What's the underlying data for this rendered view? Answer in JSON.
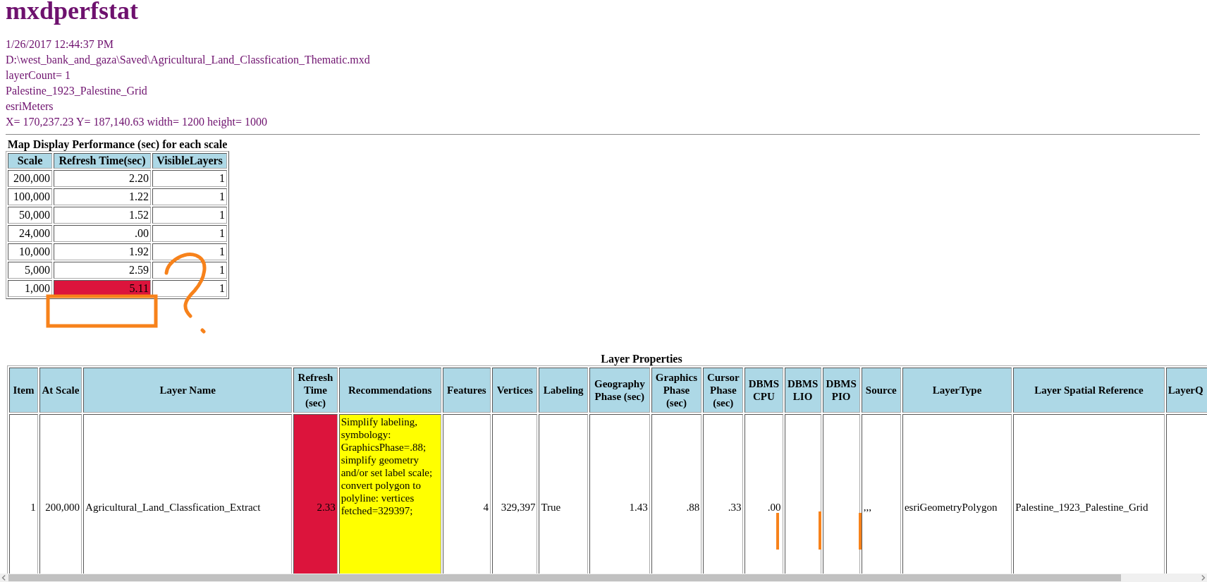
{
  "title": "mxdperfstat",
  "info_lines": [
    "1/26/2017 12:44:37 PM",
    "D:\\west_bank_and_gaza\\Saved\\Agricultural_Land_Classfication_Thematic.mxd",
    "layerCount= 1",
    "Palestine_1923_Palestine_Grid",
    "esriMeters",
    "X= 170,237.23 Y= 187,140.63 width= 1200 height= 1000"
  ],
  "scale_table": {
    "caption": "Map Display Performance (sec) for each scale",
    "columns": [
      "Scale",
      "Refresh Time(sec)",
      "VisibleLayers"
    ],
    "rows": [
      {
        "scale": "200,000",
        "refresh_time": "2.20",
        "visible_layers": "1",
        "alert": false
      },
      {
        "scale": "100,000",
        "refresh_time": "1.22",
        "visible_layers": "1",
        "alert": false
      },
      {
        "scale": "50,000",
        "refresh_time": "1.52",
        "visible_layers": "1",
        "alert": false
      },
      {
        "scale": "24,000",
        "refresh_time": ".00",
        "visible_layers": "1",
        "alert": false
      },
      {
        "scale": "10,000",
        "refresh_time": "1.92",
        "visible_layers": "1",
        "alert": false
      },
      {
        "scale": "5,000",
        "refresh_time": "2.59",
        "visible_layers": "1",
        "alert": false
      },
      {
        "scale": "1,000",
        "refresh_time": "5.11",
        "visible_layers": "1",
        "alert": true
      }
    ]
  },
  "layer_table": {
    "caption": "Layer Properties",
    "columns": [
      {
        "label": "Item",
        "kind": "number"
      },
      {
        "label": "At Scale",
        "kind": "number"
      },
      {
        "label": "Layer Name",
        "kind": "text"
      },
      {
        "label": "Refresh Time (sec)",
        "kind": "number"
      },
      {
        "label": "Recommendations",
        "kind": "text"
      },
      {
        "label": "Features",
        "kind": "number"
      },
      {
        "label": "Vertices",
        "kind": "number"
      },
      {
        "label": "Labeling",
        "kind": "text"
      },
      {
        "label": "Geography Phase (sec)",
        "kind": "number"
      },
      {
        "label": "Graphics Phase (sec)",
        "kind": "number"
      },
      {
        "label": "Cursor Phase (sec)",
        "kind": "number"
      },
      {
        "label": "DBMS CPU",
        "kind": "number"
      },
      {
        "label": "DBMS LIO",
        "kind": "number"
      },
      {
        "label": "DBMS PIO",
        "kind": "number"
      },
      {
        "label": "Source",
        "kind": "text"
      },
      {
        "label": "LayerType",
        "kind": "text"
      },
      {
        "label": "Layer Spatial Reference",
        "kind": "text"
      },
      {
        "label": "LayerQ",
        "kind": "text"
      }
    ],
    "rows": [
      {
        "cells": [
          {
            "text": "1",
            "alert": false,
            "warning": false
          },
          {
            "text": "200,000",
            "alert": false,
            "warning": false
          },
          {
            "text": "Agricultural_Land_Classfication_Extract",
            "alert": false,
            "warning": false
          },
          {
            "text": "2.33",
            "alert": true,
            "warning": false
          },
          {
            "text": "Simplify labeling, symbology: GraphicsPhase=.88; simplify geometry and/or set label scale; convert polygon to polyline: vertices fetched=329397;",
            "alert": false,
            "warning": true
          },
          {
            "text": "4",
            "alert": false,
            "warning": false
          },
          {
            "text": "329,397",
            "alert": false,
            "warning": false
          },
          {
            "text": "True",
            "alert": false,
            "warning": false
          },
          {
            "text": "1.43",
            "alert": false,
            "warning": false
          },
          {
            "text": ".88",
            "alert": false,
            "warning": false
          },
          {
            "text": ".33",
            "alert": false,
            "warning": false
          },
          {
            "text": ".00",
            "alert": false,
            "warning": false
          },
          {
            "alert": false,
            "warning": false
          },
          {
            "alert": false,
            "warning": false
          },
          {
            "text": ",,,",
            "alert": false,
            "warning": false
          },
          {
            "text": "esriGeometryPolygon",
            "alert": false,
            "warning": false
          },
          {
            "text": "Palestine_1923_Palestine_Grid",
            "alert": false,
            "warning": false
          },
          {
            "alert": false,
            "warning": false
          }
        ]
      }
    ]
  }
}
